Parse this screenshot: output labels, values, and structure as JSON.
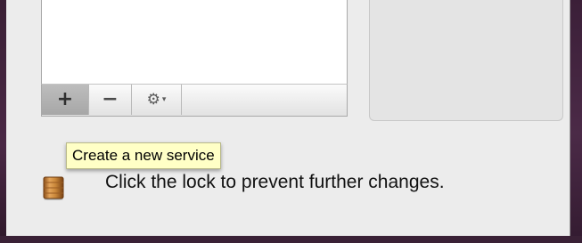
{
  "services": {
    "add_button": {
      "symbol": "+",
      "icon": "plus-icon"
    },
    "remove_button": {
      "symbol": "−",
      "icon": "minus-icon"
    },
    "action_button": {
      "symbol": "⚙",
      "caret": "▾",
      "icon": "gear-icon"
    }
  },
  "tooltip": {
    "text": "Create a new service"
  },
  "lock": {
    "icon": "lock-open-icon",
    "label": "Click the lock to prevent further changes."
  },
  "colors": {
    "desktop_frame": "#3a2136",
    "window_bg": "#ececec",
    "tooltip_bg": "#ffffc6",
    "lock_gold": "#c9873a"
  }
}
